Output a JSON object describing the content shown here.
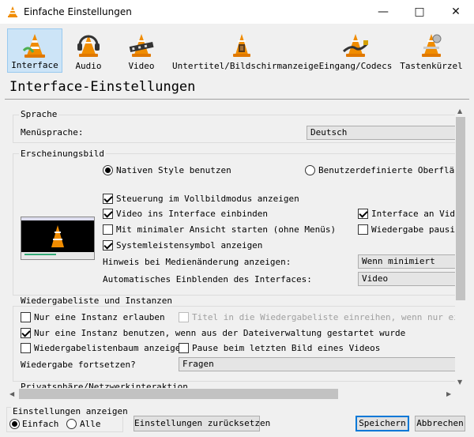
{
  "window": {
    "title": "Einfache Einstellungen",
    "minimize_icon": "minimize-icon",
    "maximize_icon": "maximize-icon",
    "close_icon": "close-icon"
  },
  "toolbar": {
    "items": [
      {
        "label": "Interface",
        "icon": "vlc-cone-icon",
        "active": true
      },
      {
        "label": "Audio",
        "icon": "headphones-cone-icon",
        "active": false
      },
      {
        "label": "Video",
        "icon": "film-cone-icon",
        "active": false
      },
      {
        "label": "Untertitel/Bildschirmanzeige",
        "icon": "subtitle-cone-icon",
        "active": false
      },
      {
        "label": "Eingang/Codecs",
        "icon": "cable-cone-icon",
        "active": false
      },
      {
        "label": "Tastenkürzel",
        "icon": "hotkeys-cone-icon",
        "active": false
      }
    ]
  },
  "page": {
    "heading": "Interface-Einstellungen"
  },
  "sprache": {
    "title": "Sprache",
    "menu_label": "Menüsprache:",
    "menu_value": "Deutsch"
  },
  "erscheinung": {
    "title": "Erscheinungsbild",
    "radio_native": "Nativen Style benutzen",
    "radio_native_checked": true,
    "radio_custom": "Benutzerdefinierte Oberfläche",
    "radio_custom_checked": false,
    "cb_fullscreen": "Steuerung im Vollbildmodus anzeigen",
    "cb_fullscreen_checked": true,
    "cb_embed": "Video ins Interface einbinden",
    "cb_embed_checked": true,
    "cb_minimal": "Mit minimaler Ansicht starten (ohne Menüs)",
    "cb_minimal_checked": false,
    "cb_systray": "Systemleistensymbol anzeigen",
    "cb_systray_checked": true,
    "cb_resize": "Interface an Video",
    "cb_resize_checked": true,
    "cb_pause": "Wiedergabe pausier",
    "cb_pause_checked": false,
    "hint_label": "Hinweis bei Medienänderung anzeigen:",
    "hint_value": "Wenn minimiert",
    "autoraise_label": "Automatisches Einblenden des Interfaces:",
    "autoraise_value": "Video"
  },
  "playlist": {
    "title": "Wiedergabeliste und Instanzen",
    "cb_one_instance": "Nur eine Instanz erlauben",
    "cb_one_instance_checked": false,
    "cb_enqueue": "Titel in die Wiedergabeliste einreihen, wenn nur eine In",
    "cb_enqueue_checked": false,
    "cb_one_instance_fm": "Nur eine Instanz benutzen, wenn aus der Dateiverwaltung gestartet wurde",
    "cb_one_instance_fm_checked": true,
    "cb_tree": "Wiedergabelistenbaum anzeigen",
    "cb_tree_checked": false,
    "cb_pause_last": "Pause beim letzten Bild eines Videos",
    "cb_pause_last_checked": false,
    "resume_label": "Wiedergabe fortsetzen?",
    "resume_value": "Fragen"
  },
  "privacy": {
    "title": "Privatsphäre/Netzwerkinteraktion"
  },
  "bottom": {
    "show_label": "Einstellungen anzeigen",
    "radio_simple": "Einfach",
    "radio_simple_checked": true,
    "radio_all": "Alle",
    "radio_all_checked": false,
    "reset_button": "Einstellungen zurücksetzen",
    "save_button": "Speichern",
    "cancel_button": "Abbrechen"
  },
  "colors": {
    "accent": "#0078d7",
    "vlc_orange": "#f08c00"
  }
}
